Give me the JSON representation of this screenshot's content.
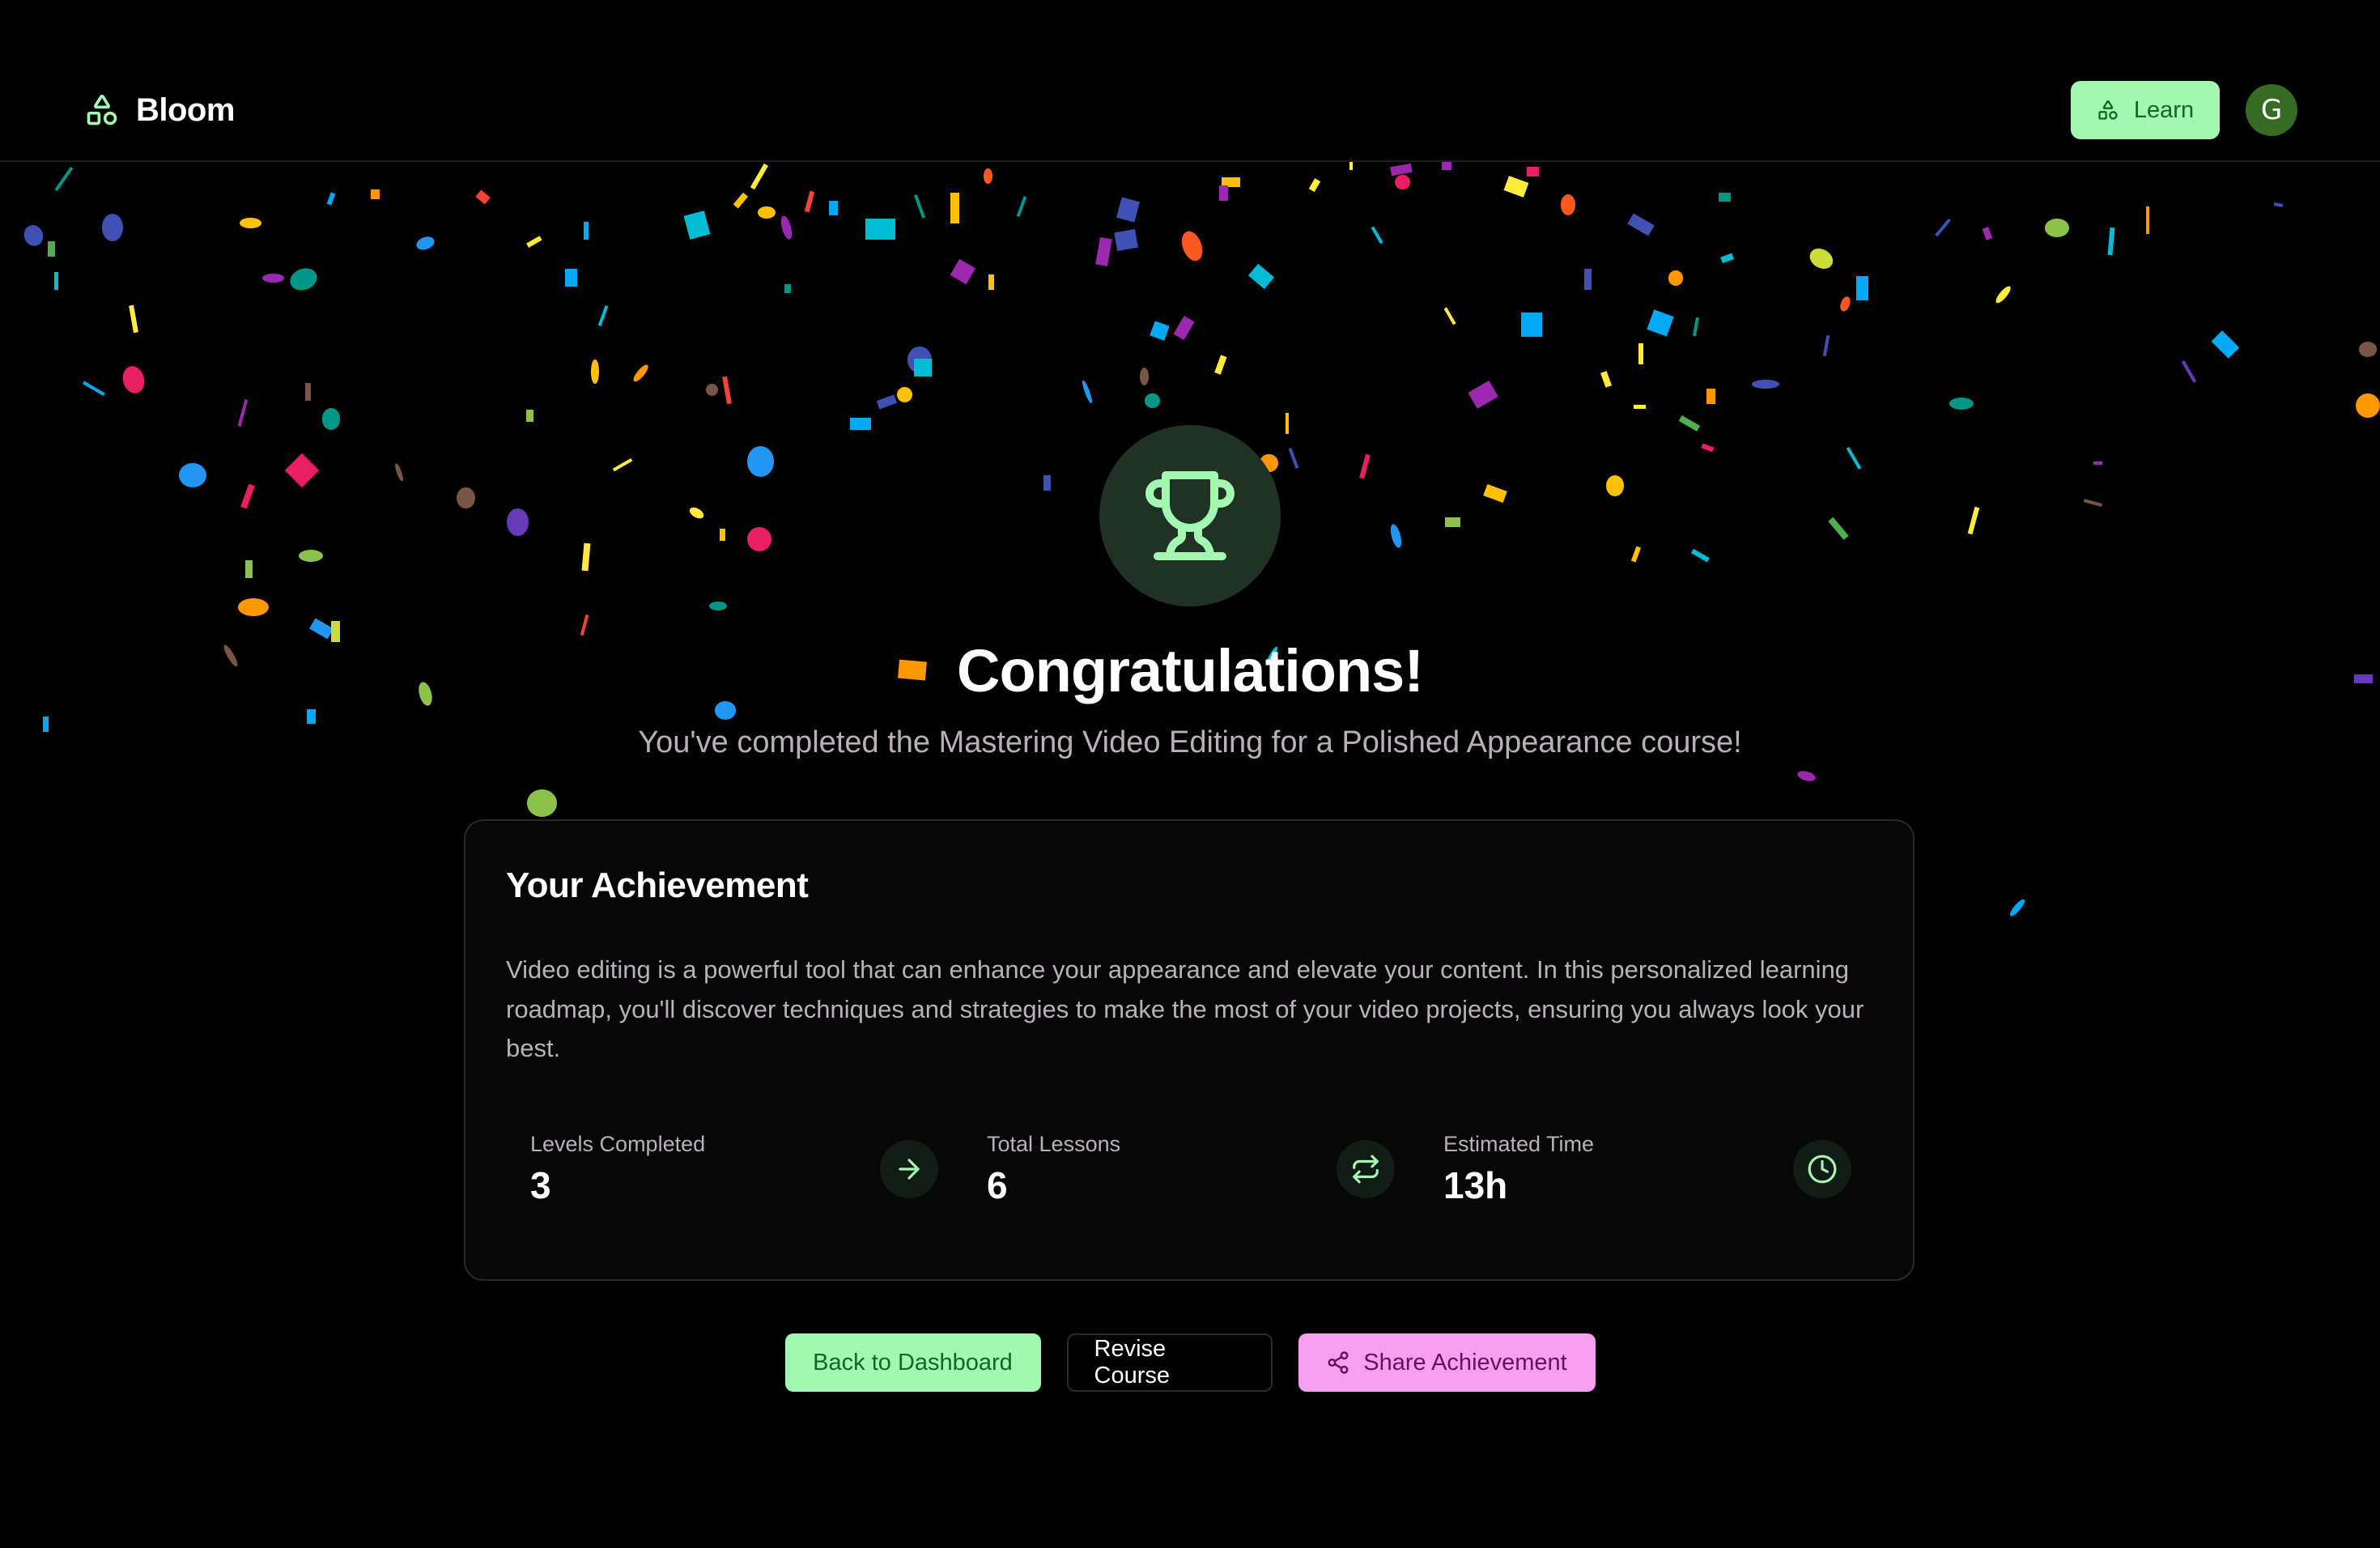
{
  "header": {
    "brand_name": "Bloom",
    "learn_label": "Learn",
    "avatar_initial": "G"
  },
  "hero": {
    "title": "Congratulations!",
    "subtitle": "You've completed the Mastering Video Editing for a Polished Appearance course!"
  },
  "achievement": {
    "title": "Your Achievement",
    "description": "Video editing is a powerful tool that can enhance your appearance and elevate your content. In this personalized learning roadmap, you'll discover techniques and strategies to make the most of your video projects, ensuring you always look your best.",
    "stats": [
      {
        "label": "Levels Completed",
        "value": "3",
        "icon": "arrow-right-icon"
      },
      {
        "label": "Total Lessons",
        "value": "6",
        "icon": "repeat-icon"
      },
      {
        "label": "Estimated Time",
        "value": "13h",
        "icon": "clock-icon"
      }
    ]
  },
  "actions": {
    "back_label": "Back to Dashboard",
    "revise_label": "Revise Course",
    "share_label": "Share Achievement"
  },
  "colors": {
    "accent_green": "#a3f7b0",
    "accent_green_text": "#15661f",
    "share_pink": "#f5a0ec",
    "share_pink_text": "#6a0e5e",
    "avatar_bg": "#356b22",
    "trophy_bg": "#203224"
  }
}
